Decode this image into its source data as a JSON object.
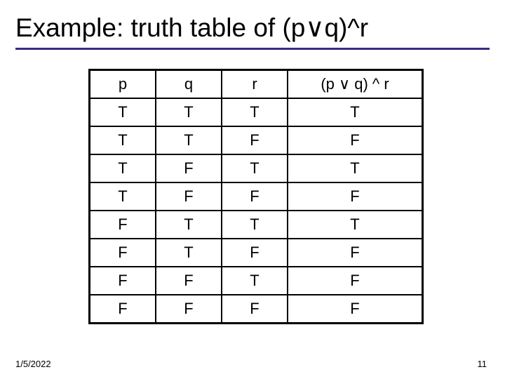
{
  "title": {
    "prefix": "Example: truth table of (p",
    "or": "∨",
    "mid": "q)",
    "and": "^",
    "suffix": "r"
  },
  "table": {
    "headers": {
      "p": "p",
      "q": "q",
      "r": "r",
      "res_prefix": "(p ",
      "res_or": "∨",
      "res_mid": " q) ",
      "res_and": "^",
      "res_suffix": " r"
    },
    "rows": [
      {
        "p": "T",
        "q": "T",
        "r": "T",
        "res": "T"
      },
      {
        "p": "T",
        "q": "T",
        "r": "F",
        "res": "F"
      },
      {
        "p": "T",
        "q": "F",
        "r": "T",
        "res": "T"
      },
      {
        "p": "T",
        "q": "F",
        "r": "F",
        "res": "F"
      },
      {
        "p": "F",
        "q": "T",
        "r": "T",
        "res": "T"
      },
      {
        "p": "F",
        "q": "T",
        "r": "F",
        "res": "F"
      },
      {
        "p": "F",
        "q": "F",
        "r": "T",
        "res": "F"
      },
      {
        "p": "F",
        "q": "F",
        "r": "F",
        "res": "F"
      }
    ]
  },
  "footer": {
    "date": "1/5/2022",
    "page": "11"
  },
  "chart_data": {
    "type": "table",
    "title": "Truth table of (p ∨ q) ^ r",
    "columns": [
      "p",
      "q",
      "r",
      "(p ∨ q) ^ r"
    ],
    "rows": [
      [
        "T",
        "T",
        "T",
        "T"
      ],
      [
        "T",
        "T",
        "F",
        "F"
      ],
      [
        "T",
        "F",
        "T",
        "T"
      ],
      [
        "T",
        "F",
        "F",
        "F"
      ],
      [
        "F",
        "T",
        "T",
        "T"
      ],
      [
        "F",
        "T",
        "F",
        "F"
      ],
      [
        "F",
        "F",
        "T",
        "F"
      ],
      [
        "F",
        "F",
        "F",
        "F"
      ]
    ]
  }
}
